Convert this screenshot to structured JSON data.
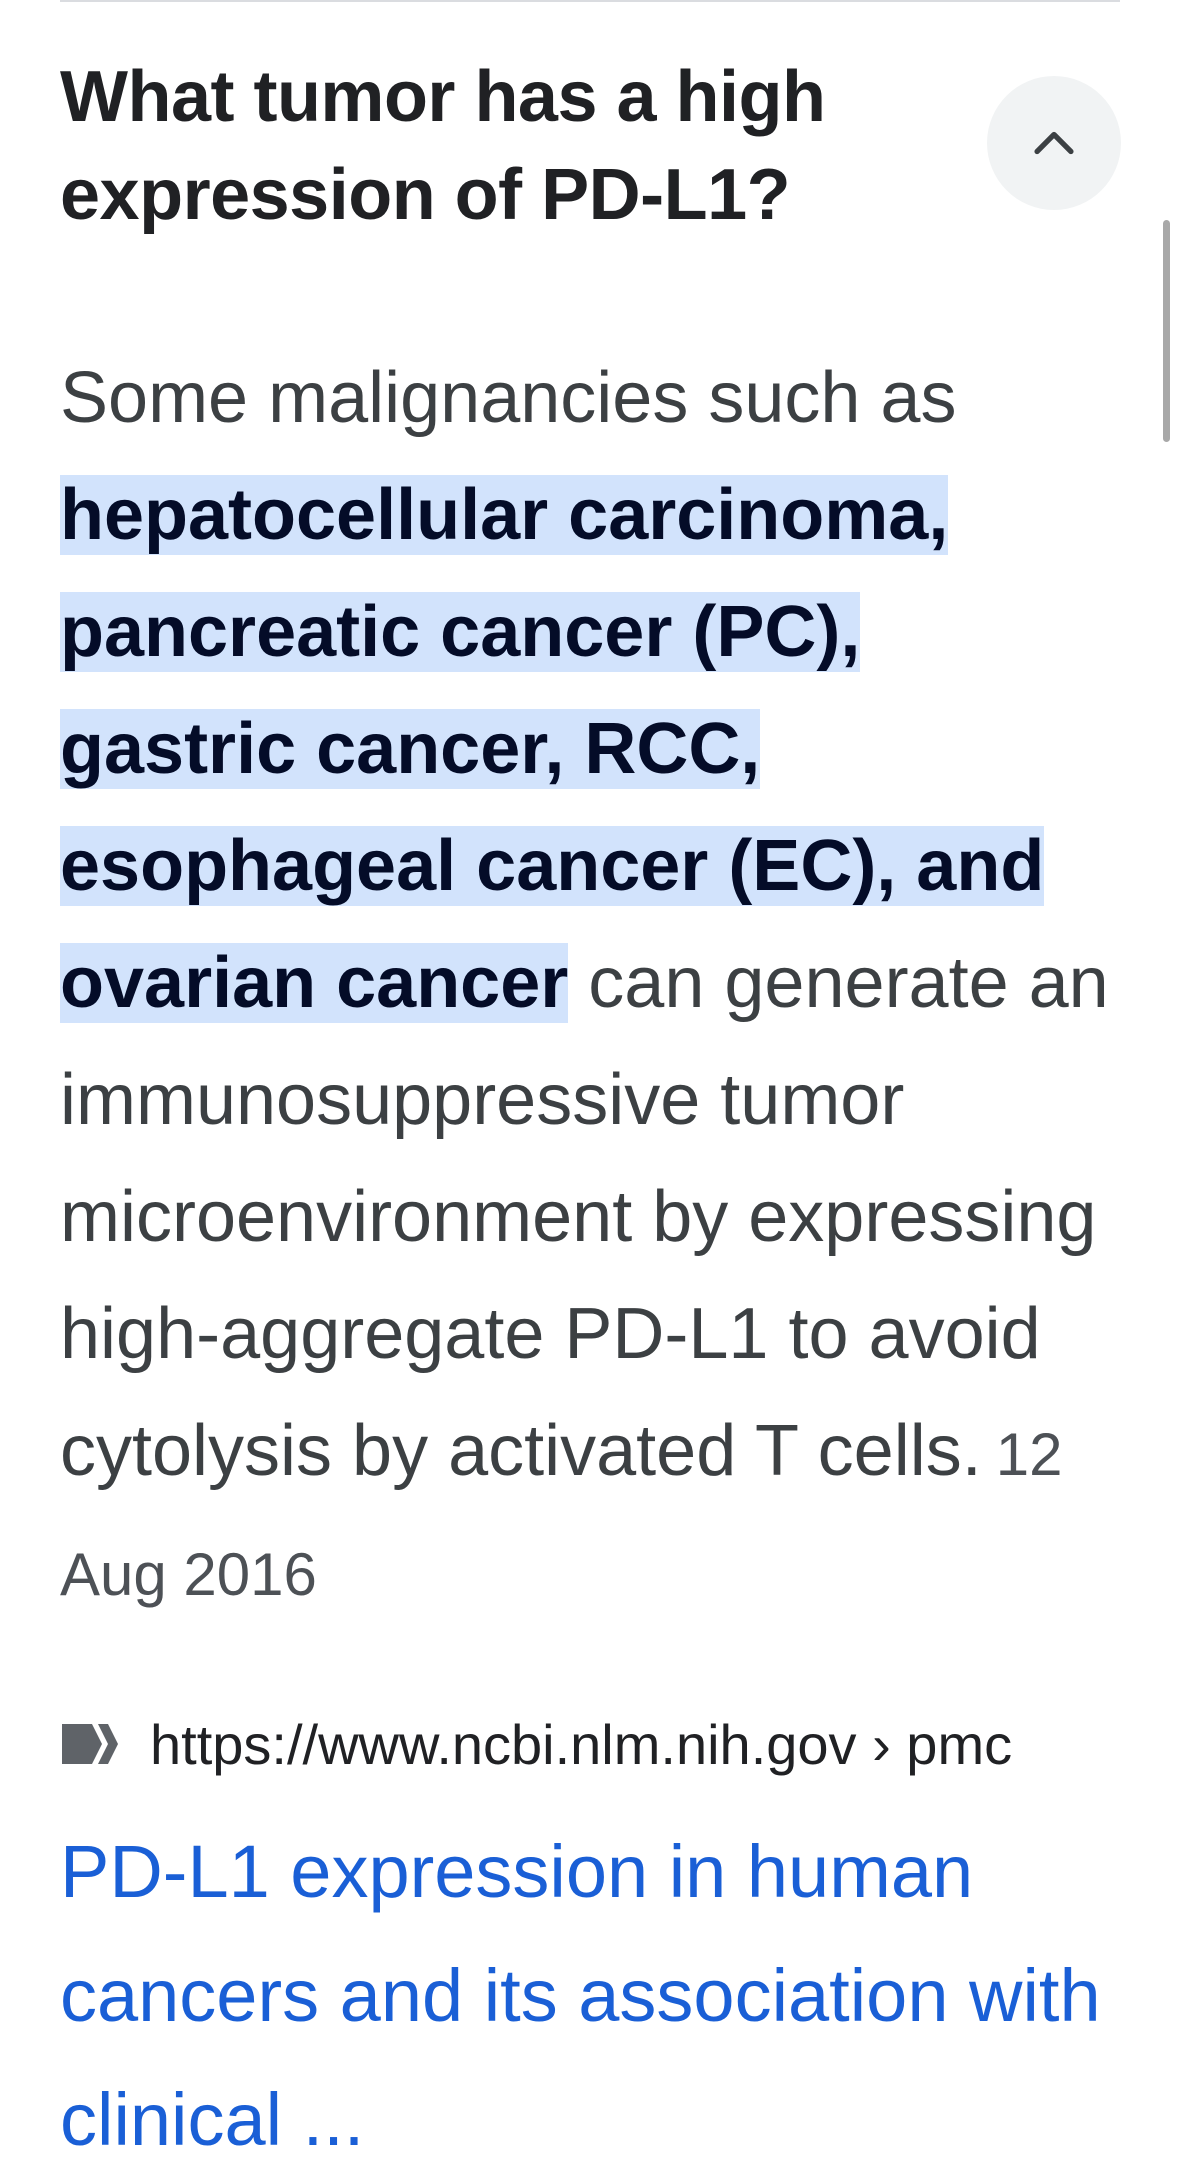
{
  "question": {
    "title": "What tumor has a high expression of PD-L1?",
    "collapse_icon": "chevron-up-icon"
  },
  "answer": {
    "intro": "Some malignancies such as ",
    "highlight_1": "hepatocellular carcinoma,",
    "highlight_2": "pancreatic cancer (PC),",
    "highlight_3": "gastric cancer, RCC,",
    "highlight_4": "esophageal cancer (EC), and",
    "highlight_5": "ovarian cancer",
    "rest": " can generate an immunosuppressive tumor microenvironment by expressing high-aggregate PD-L1 to avoid cytolysis by activated T cells.",
    "date": "12 Aug 2016"
  },
  "source": {
    "favicon": "ncbi-favicon-icon",
    "url": "https://www.ncbi.nlm.nih.gov › pmc",
    "title": "PD-L1 expression in human cancers and its association with clinical ..."
  },
  "colors": {
    "highlight_bg": "#d2e3fc",
    "link": "#1a5fd6",
    "button_bg": "#f1f3f4"
  }
}
